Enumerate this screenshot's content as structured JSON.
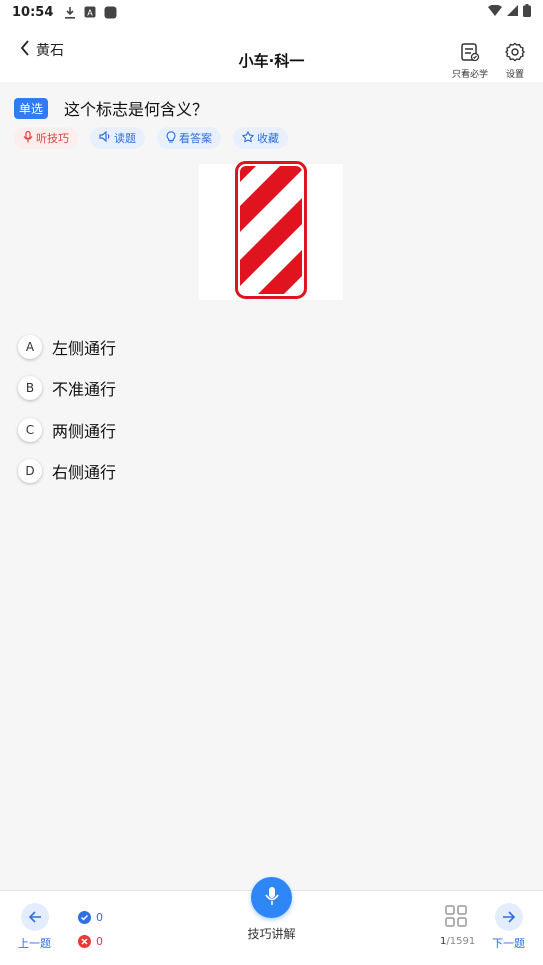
{
  "status_bar": {
    "time": "10:54",
    "icons": [
      "download-icon",
      "a-icon",
      "app-icon"
    ],
    "right_icons": [
      "wifi-icon",
      "signal-icon",
      "battery-icon"
    ]
  },
  "header": {
    "back_label": "黄石",
    "title": "小车·科一",
    "actions": [
      {
        "label": "只看必学",
        "icon": "study-list-icon"
      },
      {
        "label": "设置",
        "icon": "gear-icon"
      }
    ]
  },
  "question": {
    "type_tag": "单选",
    "text": "这个标志是何含义？",
    "chips": [
      {
        "label": "听技巧",
        "icon": "mic-icon",
        "color": "#e24040"
      },
      {
        "label": "读题",
        "icon": "speaker-icon",
        "color": "#2f6fe0"
      },
      {
        "label": "看答案",
        "icon": "bulb-icon",
        "color": "#2f6fe0"
      },
      {
        "label": "收藏",
        "icon": "star-icon",
        "color": "#2f6fe0"
      }
    ],
    "options": [
      {
        "letter": "A",
        "text": "左侧通行"
      },
      {
        "letter": "B",
        "text": "不准通行"
      },
      {
        "letter": "C",
        "text": "两侧通行"
      },
      {
        "letter": "D",
        "text": "右侧通行"
      }
    ]
  },
  "bottom_bar": {
    "prev_label": "上一题",
    "next_label": "下一题",
    "correct_count": "0",
    "wrong_count": "0",
    "tips_label": "技巧讲解",
    "progress_current": "1",
    "progress_total": "/1591"
  },
  "colors": {
    "accent": "#2f7cf6",
    "sign_red": "#e0141e",
    "correct": "#2f6fe0",
    "wrong": "#e63a3a"
  }
}
